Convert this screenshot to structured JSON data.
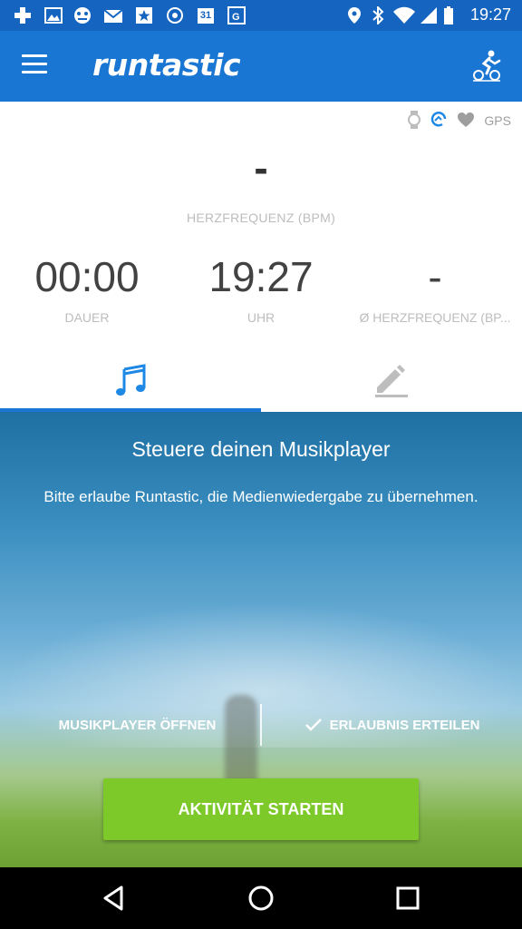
{
  "status_bar": {
    "time": "19:27",
    "left_icons": [
      "puzzle-icon",
      "image-icon",
      "game-controller-icon",
      "mail-icon",
      "star-icon",
      "record-icon",
      "calendar-icon",
      "google-plus-icon"
    ],
    "calendar_day": "31",
    "right_icons": [
      "location-icon",
      "bluetooth-icon",
      "wifi-icon",
      "cellular-icon",
      "battery-icon"
    ]
  },
  "app_bar": {
    "logo": "runtastic",
    "menu_icon": "hamburger-menu-icon",
    "activity_icon": "cycling-activity-icon"
  },
  "sensors": {
    "icons": [
      "watch-icon",
      "sync-icon",
      "heart-icon"
    ],
    "gps_label": "GPS"
  },
  "heart_rate": {
    "value": "-",
    "label": "HERZFREQUENZ (BPM)"
  },
  "stats": [
    {
      "value": "00:00",
      "label": "DAUER"
    },
    {
      "value": "19:27",
      "label": "UHR"
    },
    {
      "value": "-",
      "label": "Ø HERZFREQUENZ (BP..."
    }
  ],
  "tabs": [
    {
      "icon": "music-note-icon",
      "active": true
    },
    {
      "icon": "edit-pencil-icon",
      "active": false
    }
  ],
  "music_panel": {
    "title": "Steuere deinen Musikplayer",
    "description": "Bitte erlaube Runtastic, die Medienwiedergabe zu übernehmen.",
    "open_player_label": "MUSIKPLAYER ÖFFNEN",
    "grant_permission_label": "ERLAUBNIS ERTEILEN"
  },
  "start_button_label": "AKTIVITÄT STARTEN",
  "colors": {
    "primary": "#1976d2",
    "status_bar": "#1565c0",
    "start_button": "#7cc929"
  },
  "nav_bar": [
    "back-icon",
    "home-icon",
    "recents-icon"
  ]
}
